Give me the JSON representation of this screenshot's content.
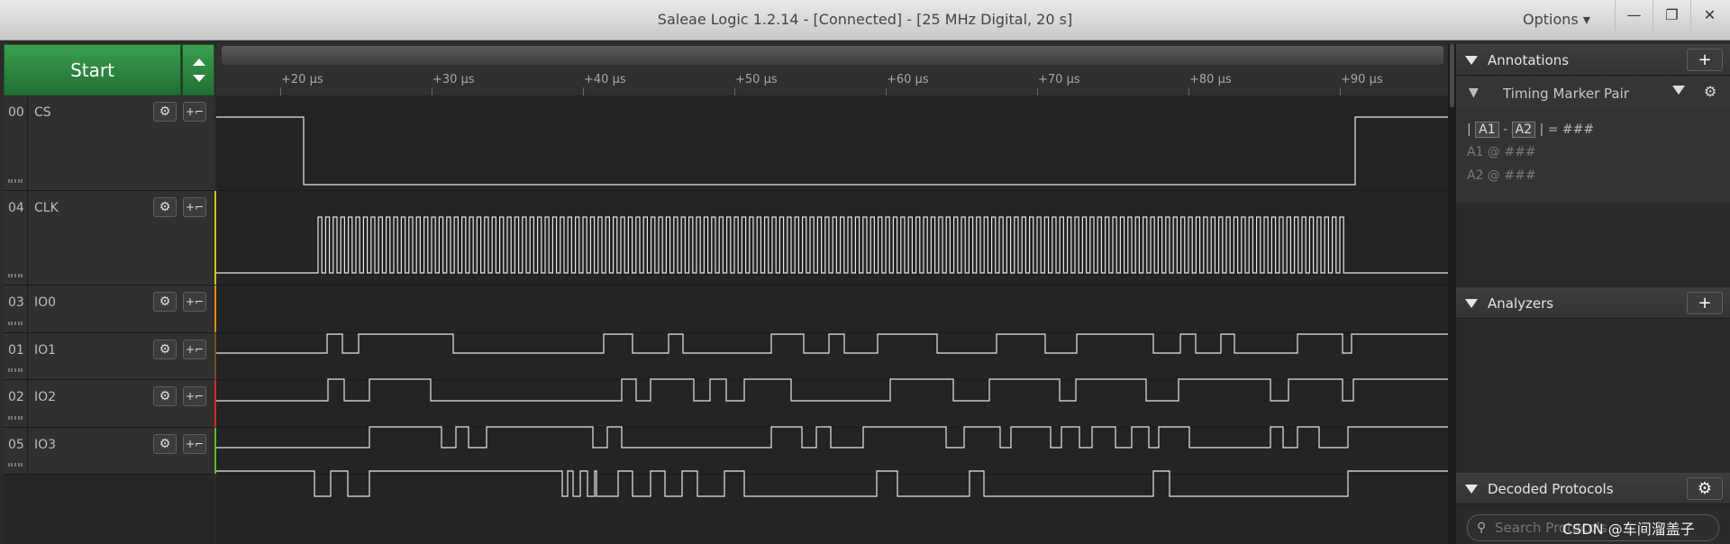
{
  "window": {
    "title": "Saleae Logic 1.2.14 - [Connected] - [25 MHz Digital, 20 s]",
    "options_label": "Options ▾",
    "minimize": "—",
    "restore": "❐",
    "close": "✕"
  },
  "capture": {
    "start_label": "Start"
  },
  "ruler": {
    "ticks": [
      "+20 µs",
      "+30 µs",
      "+40 µs",
      "+50 µs",
      "+60 µs",
      "+70 µs",
      "+80 µs",
      "+90 µs"
    ]
  },
  "channels": [
    {
      "num": "00",
      "name": "CS",
      "color": "#2a2a2a"
    },
    {
      "num": "04",
      "name": "CLK",
      "color": "#d8c21c"
    },
    {
      "num": "03",
      "name": "IO0",
      "color": "#e08a1c"
    },
    {
      "num": "01",
      "name": "IO1",
      "color": "#7a4a22"
    },
    {
      "num": "02",
      "name": "IO2",
      "color": "#d42a2a"
    },
    {
      "num": "05",
      "name": "IO3",
      "color": "#5fbf2f"
    }
  ],
  "icons": {
    "gear": "gear-icon",
    "trigger": "trigger-edge-icon"
  },
  "annotations": {
    "header": "Annotations",
    "add": "+",
    "marker_label": "Timing Marker Pair",
    "line1_prefix": "|",
    "a1": "A1",
    "dash": "-",
    "a2": "A2",
    "line1_suffix": "| = ###",
    "line2": "A1  @  ###",
    "line3": "A2  @  ###"
  },
  "analyzers": {
    "header": "Analyzers",
    "add": "+"
  },
  "decoded": {
    "header": "Decoded Protocols",
    "search_placeholder": "Search Protocols"
  },
  "watermark": "CSDN @车间溜盖子"
}
